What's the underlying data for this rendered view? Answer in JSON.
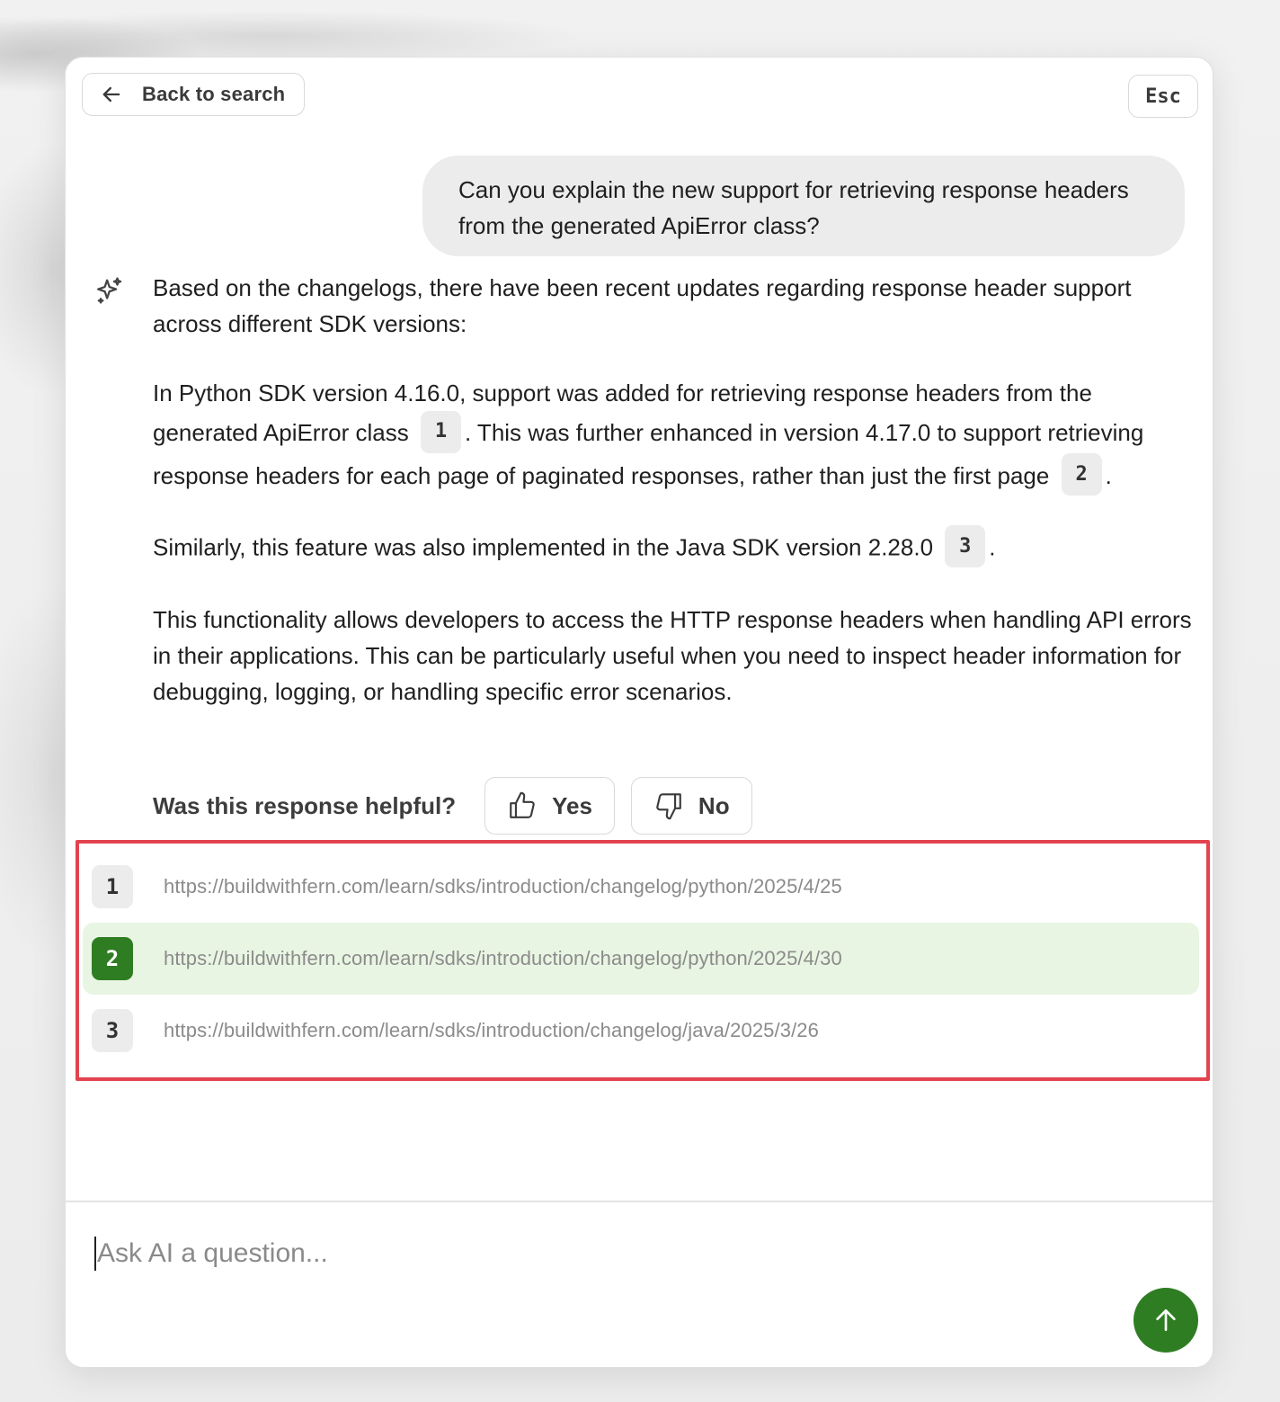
{
  "header": {
    "back_label": "Back to search",
    "esc_label": "Esc"
  },
  "conversation": {
    "question": "Can you explain the new support for retrieving response headers from the generated ApiError class?",
    "answer": {
      "intro": "Based on the changelogs, there have been recent updates regarding response header support across different SDK versions:",
      "p2_a": "In Python SDK version 4.16.0, support was added for retrieving response headers from the generated ApiError class",
      "p2_b": ". This was further enhanced in version 4.17.0 to support retrieving response headers for each page of paginated responses, rather than just the first page",
      "p2_c": ".",
      "p3_a": "Similarly, this feature was also implemented in the Java SDK version 2.28.0",
      "p3_b": ".",
      "p4": "This functionality allows developers to access the HTTP response headers when handling API errors in their applications. This can be particularly useful when you need to inspect header information for debugging, logging, or handling specific error scenarios.",
      "citations": [
        "1",
        "2",
        "3"
      ]
    }
  },
  "feedback": {
    "question": "Was this response helpful?",
    "yes_label": "Yes",
    "no_label": "No"
  },
  "sources": [
    {
      "num": "1",
      "url": "https://buildwithfern.com/learn/sdks/introduction/changelog/python/2025/4/25",
      "active": false
    },
    {
      "num": "2",
      "url": "https://buildwithfern.com/learn/sdks/introduction/changelog/python/2025/4/30",
      "active": true
    },
    {
      "num": "3",
      "url": "https://buildwithfern.com/learn/sdks/introduction/changelog/java/2025/3/26",
      "active": false
    }
  ],
  "composer": {
    "placeholder": "Ask AI a question..."
  },
  "colors": {
    "accent": "#2f7d22",
    "active_row": "#e9f5e3",
    "highlight_border": "#e2434f"
  },
  "icons": {
    "back": "arrow-left-icon",
    "ai": "sparkles-icon",
    "yes": "thumbs-up-icon",
    "no": "thumbs-down-icon",
    "send": "arrow-up-icon"
  }
}
